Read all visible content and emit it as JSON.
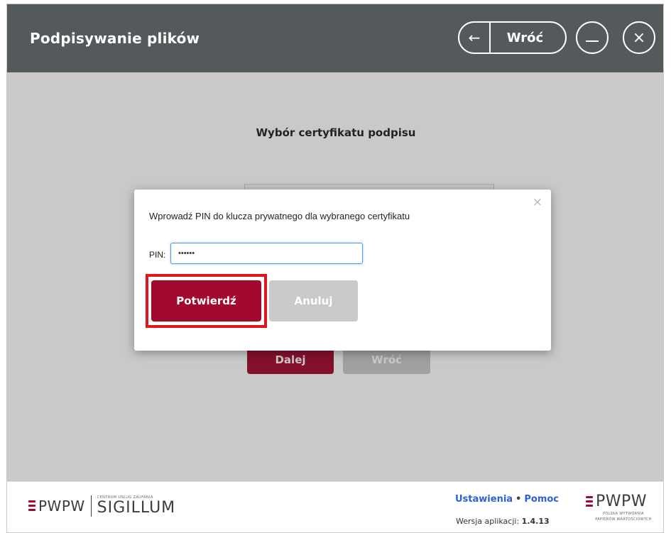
{
  "header": {
    "title": "Podpisywanie plików",
    "back_label": "Wróć",
    "back_icon": "←",
    "close_icon": "×"
  },
  "content": {
    "title": "Wybór certyfikatu podpisu",
    "next_label": "Dalej",
    "back_label": "Wróć"
  },
  "dialog": {
    "close_icon": "×",
    "message": "Wprowadź PIN do klucza prywatnego dla wybranego certyfikatu",
    "pin_label": "PIN:",
    "pin_value": "••••••",
    "confirm_label": "Potwierdź",
    "cancel_label": "Anuluj"
  },
  "footer": {
    "logo_left": {
      "brand": "PWPW",
      "small_text": "CENTRUM USŁUG ZAUFANIA",
      "name": "SIGILLUM"
    },
    "links": {
      "settings": "Ustawienia",
      "separator": "•",
      "help": "Pomoc"
    },
    "version_label": "Wersja aplikacji:",
    "version_value": "1.4.13",
    "logo_right": {
      "brand": "PWPW",
      "line1": "POLSKA WYTWÓRNIA",
      "line2": "PAPIERÓW WARTOŚCIOWYCH"
    }
  },
  "colors": {
    "header_bg": "#54595c",
    "primary": "#a3082e",
    "disabled": "#c9c9c9",
    "link": "#2f5fd8",
    "highlight": "#e0141b"
  }
}
